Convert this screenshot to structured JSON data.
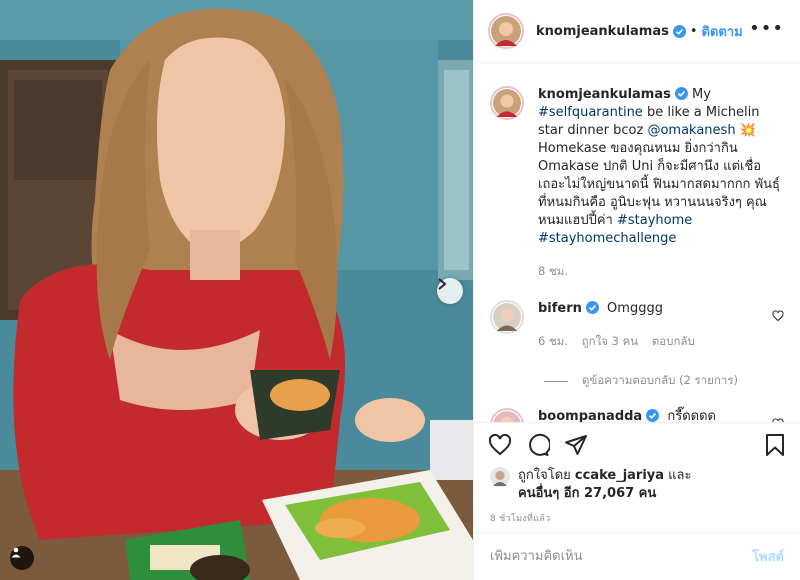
{
  "post": {
    "author": "knomjeankulamas",
    "follow_label": "ติดตาม",
    "more_label": "•••",
    "separator": "•"
  },
  "caption": {
    "username": "knomjeankulamas",
    "segments": [
      {
        "text": "My ",
        "type": "text"
      },
      {
        "text": "#selfquarantine",
        "type": "tag"
      },
      {
        "text": " be like a Michelin star dinner bcoz ",
        "type": "text"
      },
      {
        "text": "@omakanesh",
        "type": "tag"
      },
      {
        "text": " 💥 Homekase ของคุณหนม ยิ่งกว่ากิน Omakase ปกติ Uni ก็จะมีศานึง แต่เชื่อเถอะไม่ใหญ่ขนาดนี้ ฟินมากสดมากกก พันธุ์ที่หนมกินคือ อูนิบะฟุน หวานนนจริงๆ คุณหนมแฮปปี้ค่า ",
        "type": "text"
      },
      {
        "text": "#stayhome",
        "type": "tag"
      },
      {
        "text": " ",
        "type": "text"
      },
      {
        "text": "#stayhomechallenge",
        "type": "tag"
      }
    ],
    "time": "8 ชม."
  },
  "comments": [
    {
      "username": "bifern",
      "text": "Omgggg",
      "time": "6 ชม.",
      "likes": "ถูกใจ 3 คน",
      "reply": "ตอบกลับ",
      "view_replies": "ดูข้อความตอบกลับ (2 รายการ)"
    },
    {
      "username": "boompanadda",
      "text": "กรี๊ดดดด"
    }
  ],
  "likes": {
    "line1_prefix": "ถูกใจโดย",
    "liker": "ccake_jariya",
    "line1_suffix": "และ",
    "line2": "คนอื่นๆ อีก 27,067 คน"
  },
  "posted_ago": "8 ชั่วโมงที่แล้ว",
  "add_comment": {
    "placeholder": "เพิ่มความคิดเห็น",
    "post_label": "โพสต์"
  },
  "icons": {
    "verified": "verified-badge-icon",
    "next": "chevron-right-icon",
    "audio": "audio-icon",
    "like": "heart-icon",
    "comment": "comment-icon",
    "share": "paper-plane-icon",
    "save": "bookmark-icon"
  },
  "colors": {
    "link": "#00376b",
    "follow": "#3897f0",
    "verified": "#3897f0",
    "muted": "#8e8e8e"
  }
}
